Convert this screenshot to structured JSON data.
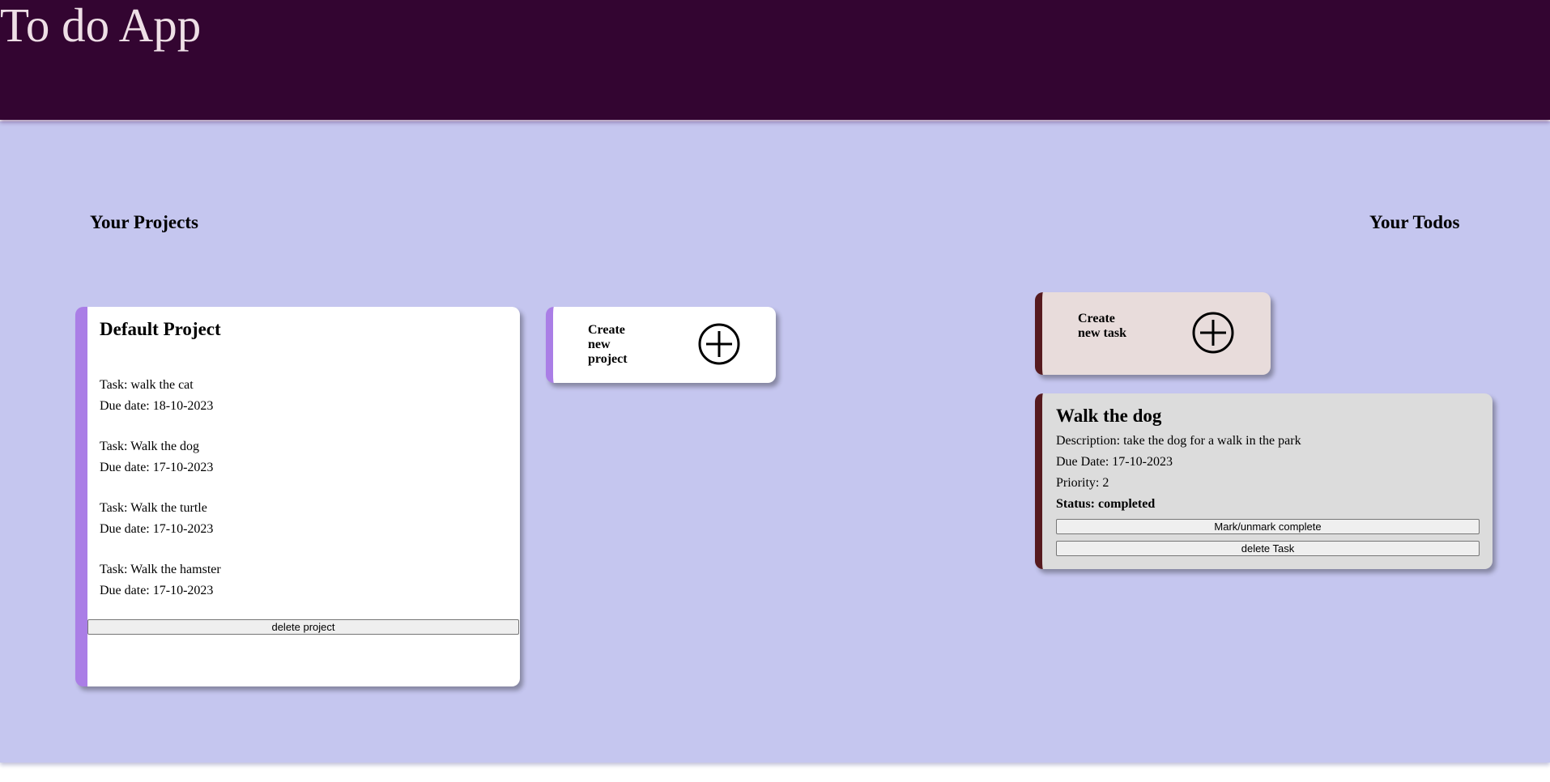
{
  "header": {
    "title": "To do App"
  },
  "projects": {
    "heading": "Your Projects",
    "items": [
      {
        "name": "Default Project",
        "tasks": [
          {
            "task": "Task: walk the cat",
            "due": "Due date: 18-10-2023"
          },
          {
            "task": "Task: Walk the dog",
            "due": "Due date: 17-10-2023"
          },
          {
            "task": "Task: Walk the turtle",
            "due": "Due date: 17-10-2023"
          },
          {
            "task": "Task: Walk the hamster",
            "due": "Due date: 17-10-2023"
          }
        ],
        "delete_label": "delete project"
      }
    ],
    "create_label": "Create new project",
    "create_icon": "plus-circle-icon"
  },
  "todos": {
    "heading": "Your Todos",
    "create_label": "Create new task",
    "create_icon": "plus-circle-icon",
    "items": [
      {
        "title": "Walk the dog",
        "description": "Description: take the dog for a walk in the park",
        "due": "Due Date: 17-10-2023",
        "priority": "Priority: 2",
        "status": "Status: completed",
        "toggle_label": "Mark/unmark complete",
        "delete_label": "delete Task"
      }
    ]
  },
  "colors": {
    "header_bg": "#330531",
    "header_text": "#eedfe6",
    "main_bg": "#c5c6ef",
    "project_accent": "#aa7ee6",
    "todo_accent": "#561a1f",
    "create_task_bg": "#e8dcdb",
    "todo_card_bg": "#dcdcdc"
  }
}
